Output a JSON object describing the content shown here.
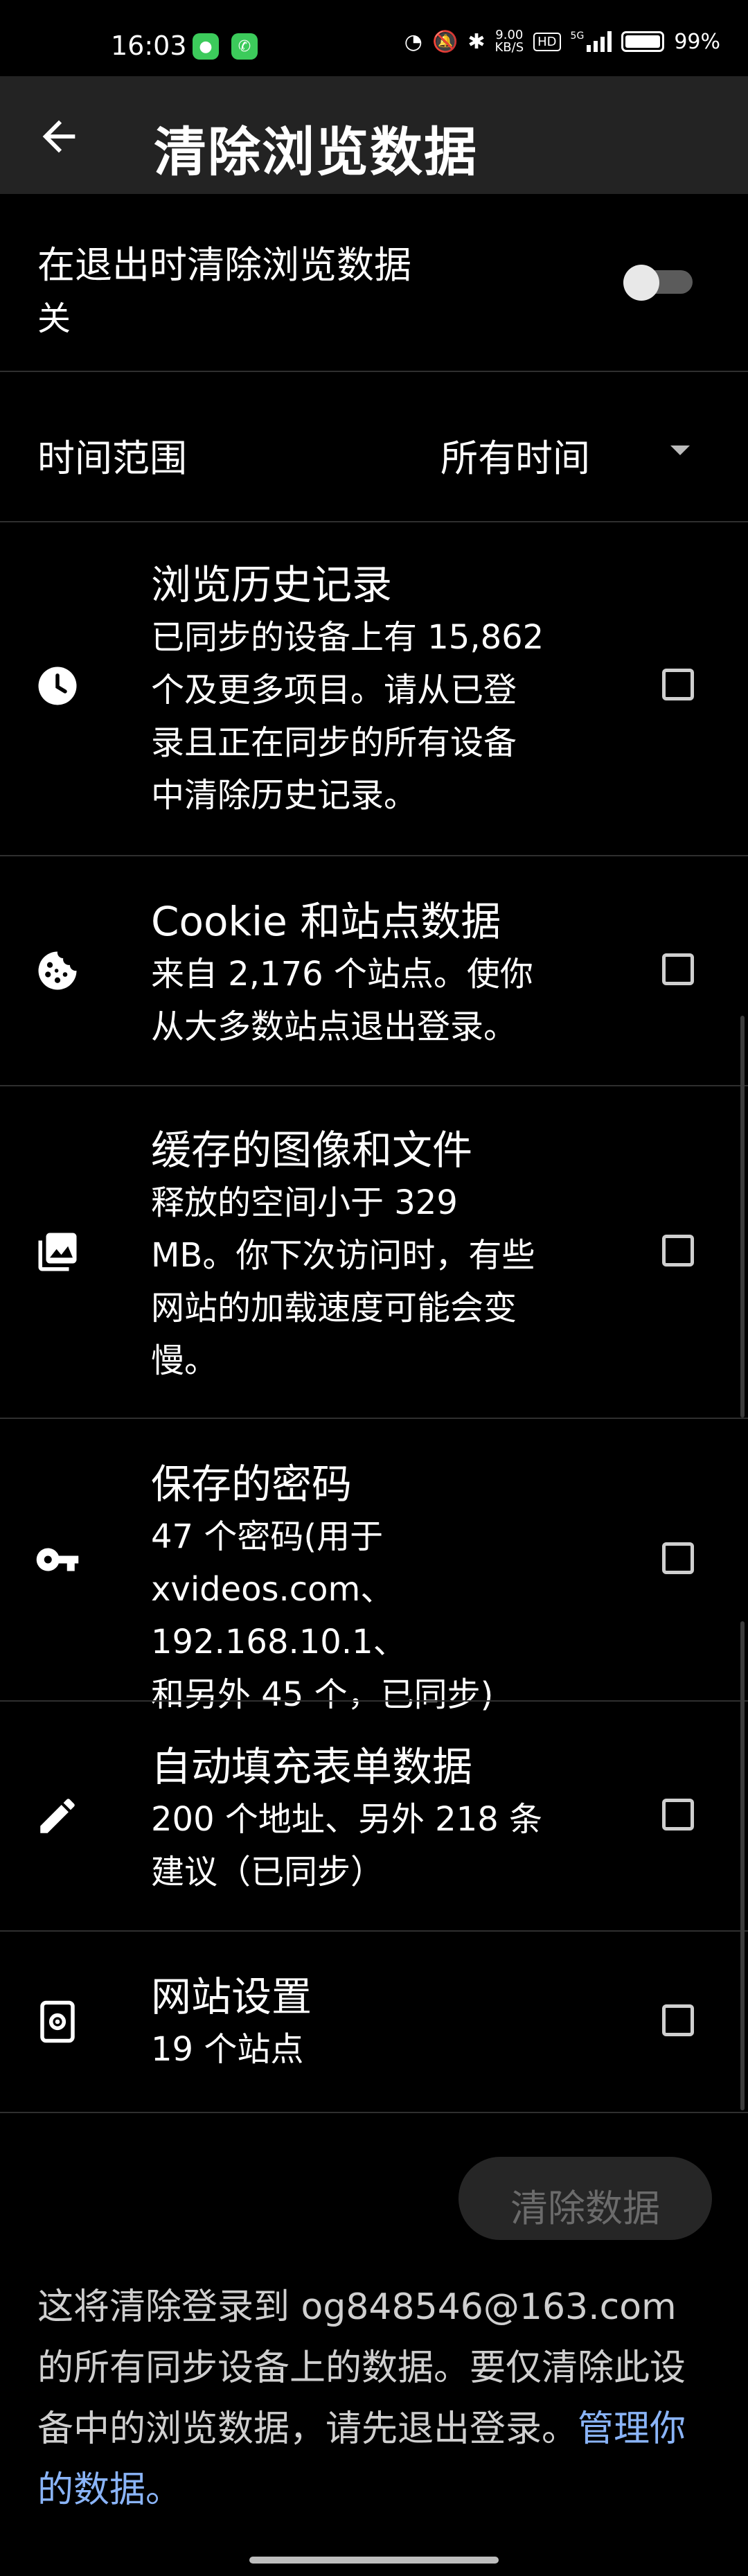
{
  "status_bar": {
    "time": "16:03",
    "net_speed_value": "9.00",
    "net_speed_unit": "KB/S",
    "hd_label": "HD",
    "signal_label": "5G",
    "battery": "99%",
    "battery_level": 0.99
  },
  "toolbar": {
    "title": "清除浏览数据"
  },
  "exit_clear": {
    "label": "在退出时清除浏览数据",
    "state": "关",
    "enabled": false
  },
  "time_range": {
    "label": "时间范围",
    "value": "所有时间"
  },
  "items": [
    {
      "title": "浏览历史记录",
      "lines": [
        "已同步的设备上有 15,862",
        "个及更多项目。请从已登",
        "录且正在同步的所有设备",
        "中清除历史记录。"
      ],
      "icon": "history-icon",
      "checked": false
    },
    {
      "title": "Cookie 和站点数据",
      "lines": [
        "来自 2,176 个站点。使你",
        "从大多数站点退出登录。"
      ],
      "icon": "cookie-icon",
      "checked": false
    },
    {
      "title": "缓存的图像和文件",
      "lines": [
        "释放的空间小于 329",
        "MB。你下次访问时，有些",
        "网站的加载速度可能会变",
        "慢。"
      ],
      "icon": "image-icon",
      "checked": false
    },
    {
      "title": "保存的密码",
      "lines": [
        "47 个密码(用于",
        "xvideos.com、192.168.10.1、",
        "和另外 45 个，已同步)"
      ],
      "icon": "key-icon",
      "checked": false
    },
    {
      "title": "自动填充表单数据",
      "lines": [
        "200 个地址、另外 218 条",
        "建议（已同步）"
      ],
      "icon": "pencil-icon",
      "checked": false
    },
    {
      "title": "网站设置",
      "lines": [
        "19 个站点"
      ],
      "icon": "site-settings-icon",
      "checked": false
    }
  ],
  "clear_button": {
    "label": "清除数据"
  },
  "footer": {
    "text": "这将清除登录到 og848546@163.com 的所有同步设备上的数据。要仅清除此设备中的浏览数据，请先退出登录。",
    "link": "管理你的数据。"
  },
  "colors": {
    "background": "#000000",
    "toolbar": "#232323",
    "link": "#8ab4f8",
    "disabled_text": "#6b6b6b"
  }
}
